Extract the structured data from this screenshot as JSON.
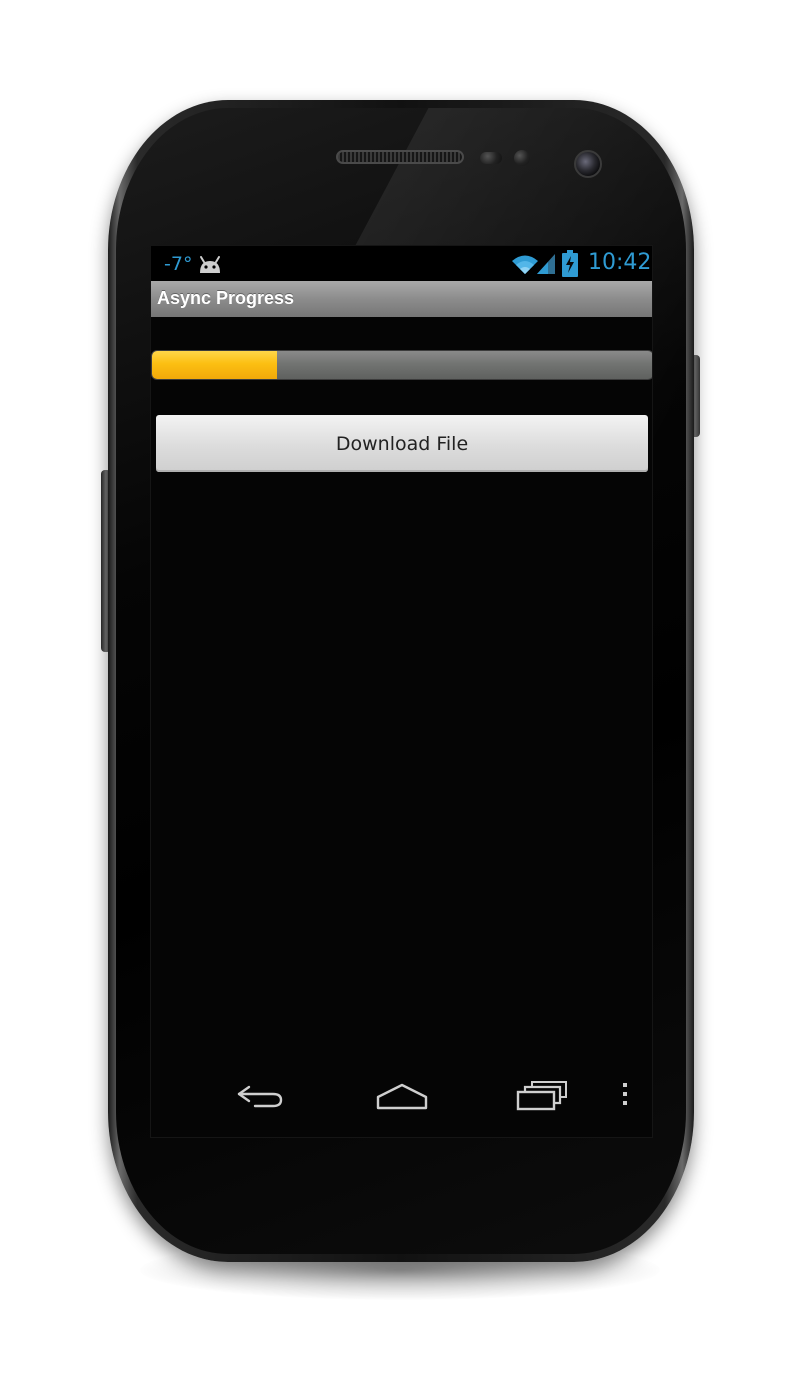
{
  "status_bar": {
    "temperature": "-7°",
    "time": "10:42",
    "accent_color": "#2f9bd3",
    "icons": [
      "android-icon",
      "wifi-icon",
      "signal-icon",
      "battery-charging-icon"
    ]
  },
  "action_bar": {
    "title": "Async Progress"
  },
  "progress_bar": {
    "value": 0.25,
    "fill_color": "#fcbf12"
  },
  "download_button": {
    "label": "Download File"
  },
  "nav_bar": {
    "icons": [
      "back-icon",
      "home-icon",
      "recent-apps-icon",
      "overflow-menu-icon"
    ]
  }
}
